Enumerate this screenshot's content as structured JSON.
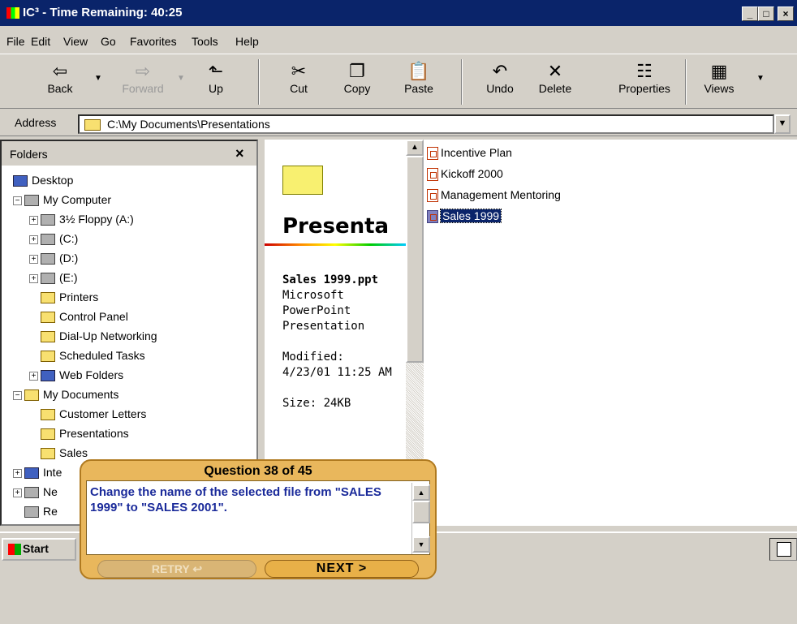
{
  "window": {
    "title": "IC³ - Time Remaining:  40:25",
    "min": "_",
    "max": "□",
    "close": "×"
  },
  "menu": [
    "File",
    "Edit",
    "View",
    "Go",
    "Favorites",
    "Tools",
    "Help"
  ],
  "toolbar": {
    "back": "Back",
    "forward": "Forward",
    "up": "Up",
    "cut": "Cut",
    "copy": "Copy",
    "paste": "Paste",
    "undo": "Undo",
    "delete": "Delete",
    "properties": "Properties",
    "views": "Views"
  },
  "address": {
    "label": "Address",
    "value": "C:\\My Documents\\Presentations"
  },
  "folders": {
    "header": "Folders",
    "close": "×",
    "items": [
      "Desktop",
      "My Computer",
      "3½ Floppy (A:)",
      "(C:)",
      "(D:)",
      "(E:)",
      "Printers",
      "Control Panel",
      "Dial-Up Networking",
      "Scheduled Tasks",
      "Web Folders",
      "My Documents",
      "Customer Letters",
      "Presentations",
      "Sales",
      "Inte",
      "Ne",
      "Re"
    ]
  },
  "webview": {
    "title": "Presenta",
    "file_name": "Sales 1999.ppt",
    "file_type": "Microsoft PowerPoint Presentation",
    "modified_label": "Modified:",
    "modified": "4/23/01 11:25 AM",
    "size": "Size: 24KB"
  },
  "files": [
    "Incentive Plan",
    "Kickoff 2000",
    "Management Mentoring",
    "Sales 1999"
  ],
  "taskbar": {
    "start": "Start"
  },
  "question": {
    "title": "Question 38 of 45",
    "text": "Change the name of the selected file from \"SALES 1999\" to \"SALES 2001\".",
    "retry": "RETRY ↩",
    "next": "NEXT >"
  }
}
